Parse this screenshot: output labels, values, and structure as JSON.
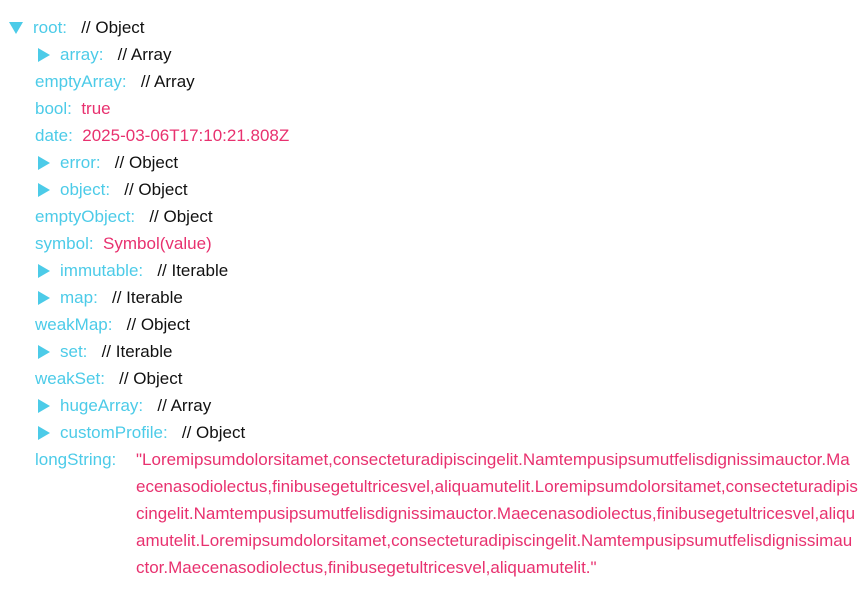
{
  "colors": {
    "key": "#4ccbe8",
    "value": "#e8316f",
    "comment": "#111111",
    "caret": "#4ccbe8"
  },
  "root": {
    "key": "root:",
    "comment": "// Object"
  },
  "entries": [
    {
      "key": "array:",
      "comment": "// Array",
      "expandable": true
    },
    {
      "key": "emptyArray:",
      "comment": "// Array",
      "expandable": false
    },
    {
      "key": "bool:",
      "value": "true",
      "expandable": false
    },
    {
      "key": "date:",
      "value": "2025-03-06T17:10:21.808Z",
      "expandable": false
    },
    {
      "key": "error:",
      "comment": "// Object",
      "expandable": true
    },
    {
      "key": "object:",
      "comment": "// Object",
      "expandable": true
    },
    {
      "key": "emptyObject:",
      "comment": "// Object",
      "expandable": false
    },
    {
      "key": "symbol:",
      "value": "Symbol(value)",
      "expandable": false
    },
    {
      "key": "immutable:",
      "comment": "// Iterable",
      "expandable": true
    },
    {
      "key": "map:",
      "comment": "// Iterable",
      "expandable": true
    },
    {
      "key": "weakMap:",
      "comment": "// Object",
      "expandable": false
    },
    {
      "key": "set:",
      "comment": "// Iterable",
      "expandable": true
    },
    {
      "key": "weakSet:",
      "comment": "// Object",
      "expandable": false
    },
    {
      "key": "hugeArray:",
      "comment": "// Array",
      "expandable": true
    },
    {
      "key": "customProfile:",
      "comment": "// Object",
      "expandable": true
    }
  ],
  "longString": {
    "key": "longString:",
    "value": "\"Loremipsumdolorsitamet,consecteturadipiscingelit.Namtempusipsumutfelisdignissimauctor.Maecenasodiolectus,finibusegetultricesvel,aliquamutelit.Loremipsumdolorsitamet,consecteturadipiscingelit.Namtempusipsumutfelisdignissimauctor.Maecenasodiolectus,finibusegetultricesvel,aliquamutelit.Loremipsumdolorsitamet,consecteturadipiscingelit.Namtempusipsumutfelisdignissimauctor.Maecenasodiolectus,finibusegetultricesvel,aliquamutelit.\""
  }
}
